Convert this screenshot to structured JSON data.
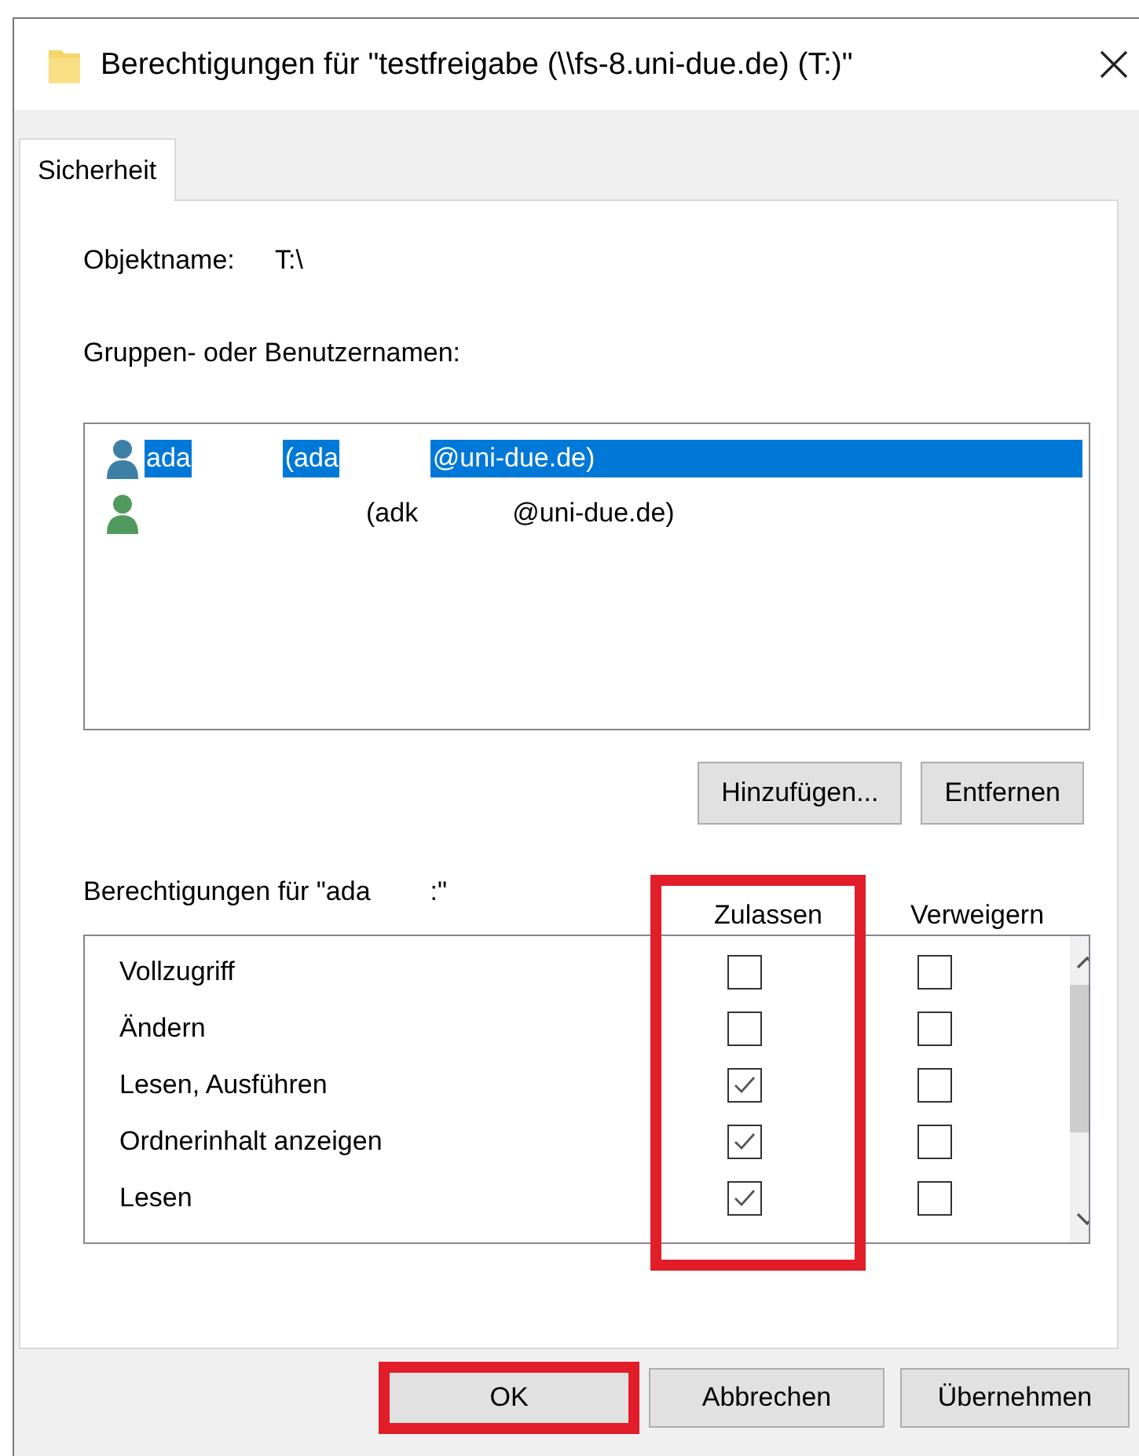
{
  "window": {
    "title": "Berechtigungen für \"testfreigabe (\\\\fs-8.uni-due.de) (T:)\""
  },
  "tabs": [
    {
      "label": "Sicherheit",
      "selected": true
    }
  ],
  "object_name": {
    "label": "Objektname:",
    "value": "T:\\"
  },
  "groups": {
    "label": "Gruppen- oder Benutzernamen:",
    "users": [
      {
        "selected": true,
        "color": "#3d7fa6",
        "parts": [
          {
            "kind": "text",
            "text": "ada"
          },
          {
            "kind": "redacted"
          },
          {
            "kind": "text",
            "text": "(ada"
          },
          {
            "kind": "redacted"
          },
          {
            "kind": "text",
            "text": "@uni-due.de)"
          }
        ]
      },
      {
        "selected": false,
        "color": "#4f9a5c",
        "parts": [
          {
            "kind": "redacted-wide"
          },
          {
            "kind": "text",
            "text": "(adk"
          },
          {
            "kind": "redacted"
          },
          {
            "kind": "text",
            "text": "@uni-due.de)"
          }
        ]
      }
    ]
  },
  "group_buttons": [
    "Hinzufügen...",
    "Entfernen"
  ],
  "permissions": {
    "label": "Berechtigungen für \"ada",
    "label_end": ":\"",
    "columns": [
      {
        "label": "Zulassen",
        "highlighted": true
      },
      {
        "label": "Verweigern",
        "highlighted": false
      }
    ],
    "rows": [
      {
        "label": "Vollzugriff",
        "allow": false,
        "deny": false
      },
      {
        "label": "Ändern",
        "allow": false,
        "deny": false
      },
      {
        "label": "Lesen, Ausführen",
        "allow": true,
        "deny": false
      },
      {
        "label": "Ordnerinhalt anzeigen",
        "allow": true,
        "deny": false
      },
      {
        "label": "Lesen",
        "allow": true,
        "deny": false
      }
    ]
  },
  "buttons": [
    {
      "label": "OK",
      "highlighted": true
    },
    {
      "label": "Abbrechen",
      "highlighted": false
    },
    {
      "label": "Übernehmen",
      "highlighted": false
    }
  ]
}
